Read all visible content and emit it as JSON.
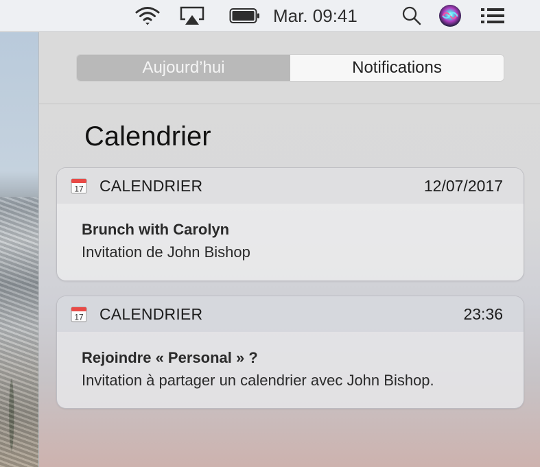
{
  "menubar": {
    "icons": [
      "wifi-icon",
      "airplay-icon",
      "battery-icon",
      "spotlight-search-icon",
      "siri-icon",
      "notification-center-icon"
    ],
    "clock": "Mar. 09:41"
  },
  "panel": {
    "tabs": [
      {
        "label": "Aujourd’hui",
        "selected": false
      },
      {
        "label": "Notifications",
        "selected": true
      }
    ],
    "section_title": "Calendrier",
    "notifications": [
      {
        "app_icon": "calendar-icon",
        "icon_day": "17",
        "app_name": "CALENDRIER",
        "time": "12/07/2017",
        "title": "Brunch with Carolyn",
        "subtitle": "Invitation de John Bishop"
      },
      {
        "app_icon": "calendar-icon",
        "icon_day": "17",
        "app_name": "CALENDRIER",
        "time": "23:36",
        "title": "Rejoindre « Personal » ?",
        "subtitle": "Invitation à partager un calendrier avec John Bishop."
      }
    ]
  },
  "colors": {
    "selected_tab_bg": "#f7f7f7",
    "unselected_tab_bg": "#b9b9b9",
    "calendar_red": "#e84a46"
  }
}
